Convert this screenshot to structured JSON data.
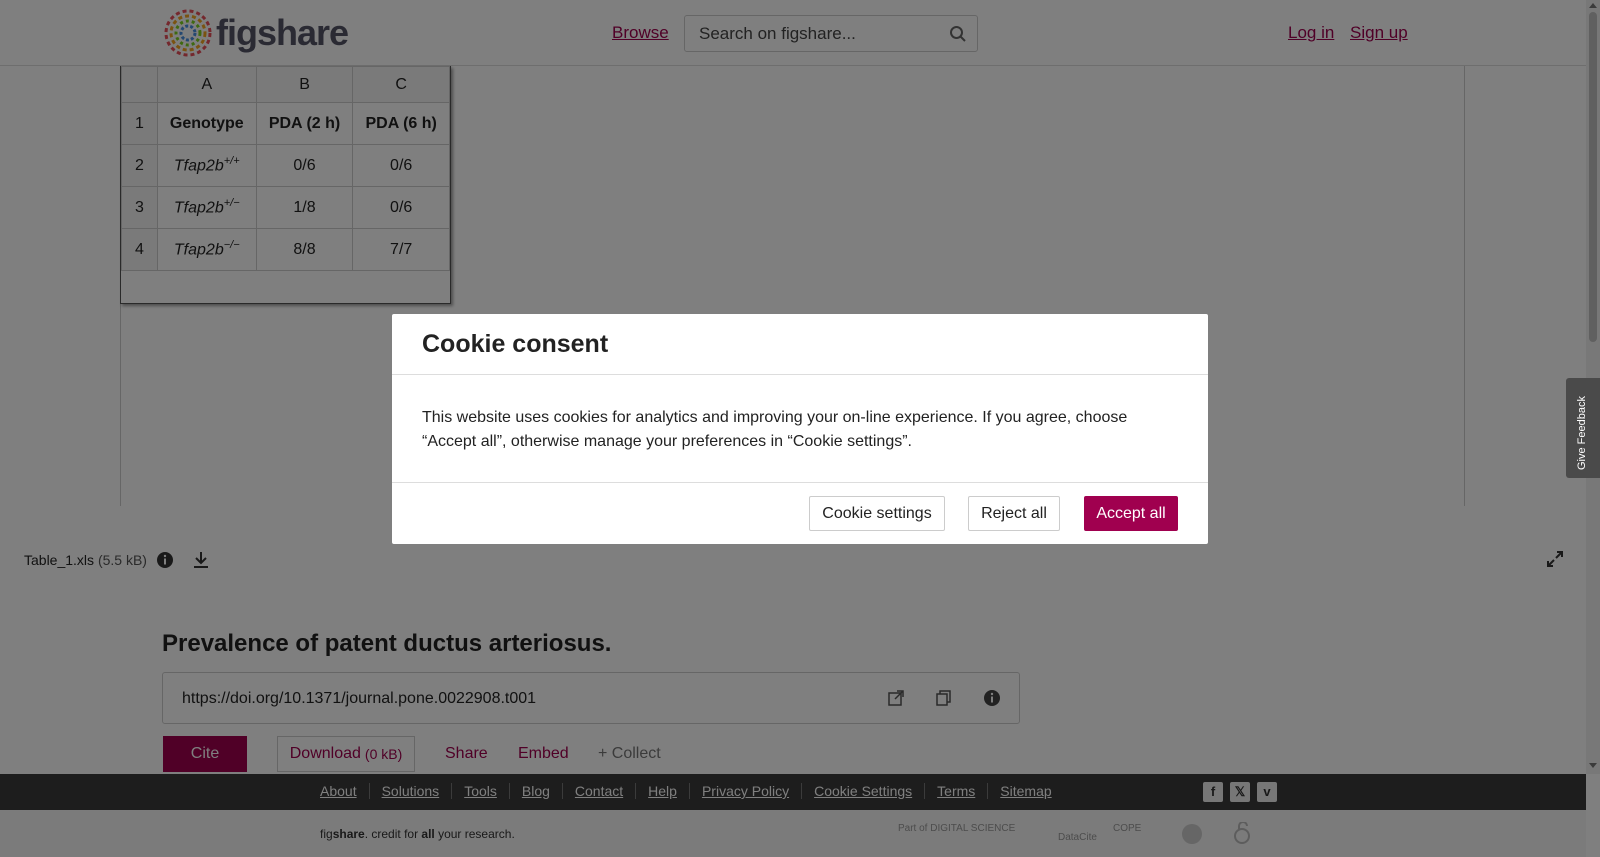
{
  "header": {
    "logo_text": "figshare",
    "browse": "Browse",
    "search_placeholder": "Search on figshare...",
    "login": "Log in",
    "signup": "Sign up"
  },
  "spreadsheet": {
    "column_headers": [
      "A",
      "B",
      "C"
    ],
    "rows": [
      {
        "num": "1",
        "cells": [
          "Genotype",
          "PDA (2 h)",
          "PDA (6 h)"
        ]
      },
      {
        "num": "2",
        "gene": "Tfap2b",
        "sup": "+/+",
        "cells": [
          "0/6",
          "0/6"
        ]
      },
      {
        "num": "3",
        "gene": "Tfap2b",
        "sup": "+/−",
        "cells": [
          "1/8",
          "0/6"
        ]
      },
      {
        "num": "4",
        "gene": "Tfap2b",
        "sup": "−/−",
        "cells": [
          "8/8",
          "7/7"
        ]
      }
    ]
  },
  "file": {
    "name": "Table_1.xls",
    "size": "(5.5 kB)"
  },
  "item": {
    "title": "Prevalence of patent ductus arteriosus.",
    "doi": "https://doi.org/10.1371/journal.pone.0022908.t001",
    "cite": "Cite",
    "download": "Download",
    "download_size": "(0 kB)",
    "share": "Share",
    "embed": "Embed",
    "collect": "+ Collect"
  },
  "footer": {
    "links": [
      "About",
      "Solutions",
      "Tools",
      "Blog",
      "Contact",
      "Help",
      "Privacy Policy",
      "Cookie Settings",
      "Terms",
      "Sitemap"
    ],
    "tagline_pre": "fig",
    "tagline_bold": "share",
    "tagline_mid": ". credit for ",
    "tagline_all": "all",
    "tagline_end": " your research.",
    "partners": [
      "Part of DIGITAL SCIENCE",
      "DataCite",
      "COPE"
    ]
  },
  "cookie_modal": {
    "title": "Cookie consent",
    "body": "This website uses cookies for analytics and improving your on-line experience. If you agree, choose “Accept all”, otherwise manage your preferences in “Cookie settings”.",
    "settings_button": "Cookie settings",
    "reject_button": "Reject all",
    "accept_button": "Accept all"
  },
  "feedback_tab": "Give Feedback",
  "colors": {
    "brand": "#a0004f",
    "footer_dark": "#3a3a3a"
  }
}
